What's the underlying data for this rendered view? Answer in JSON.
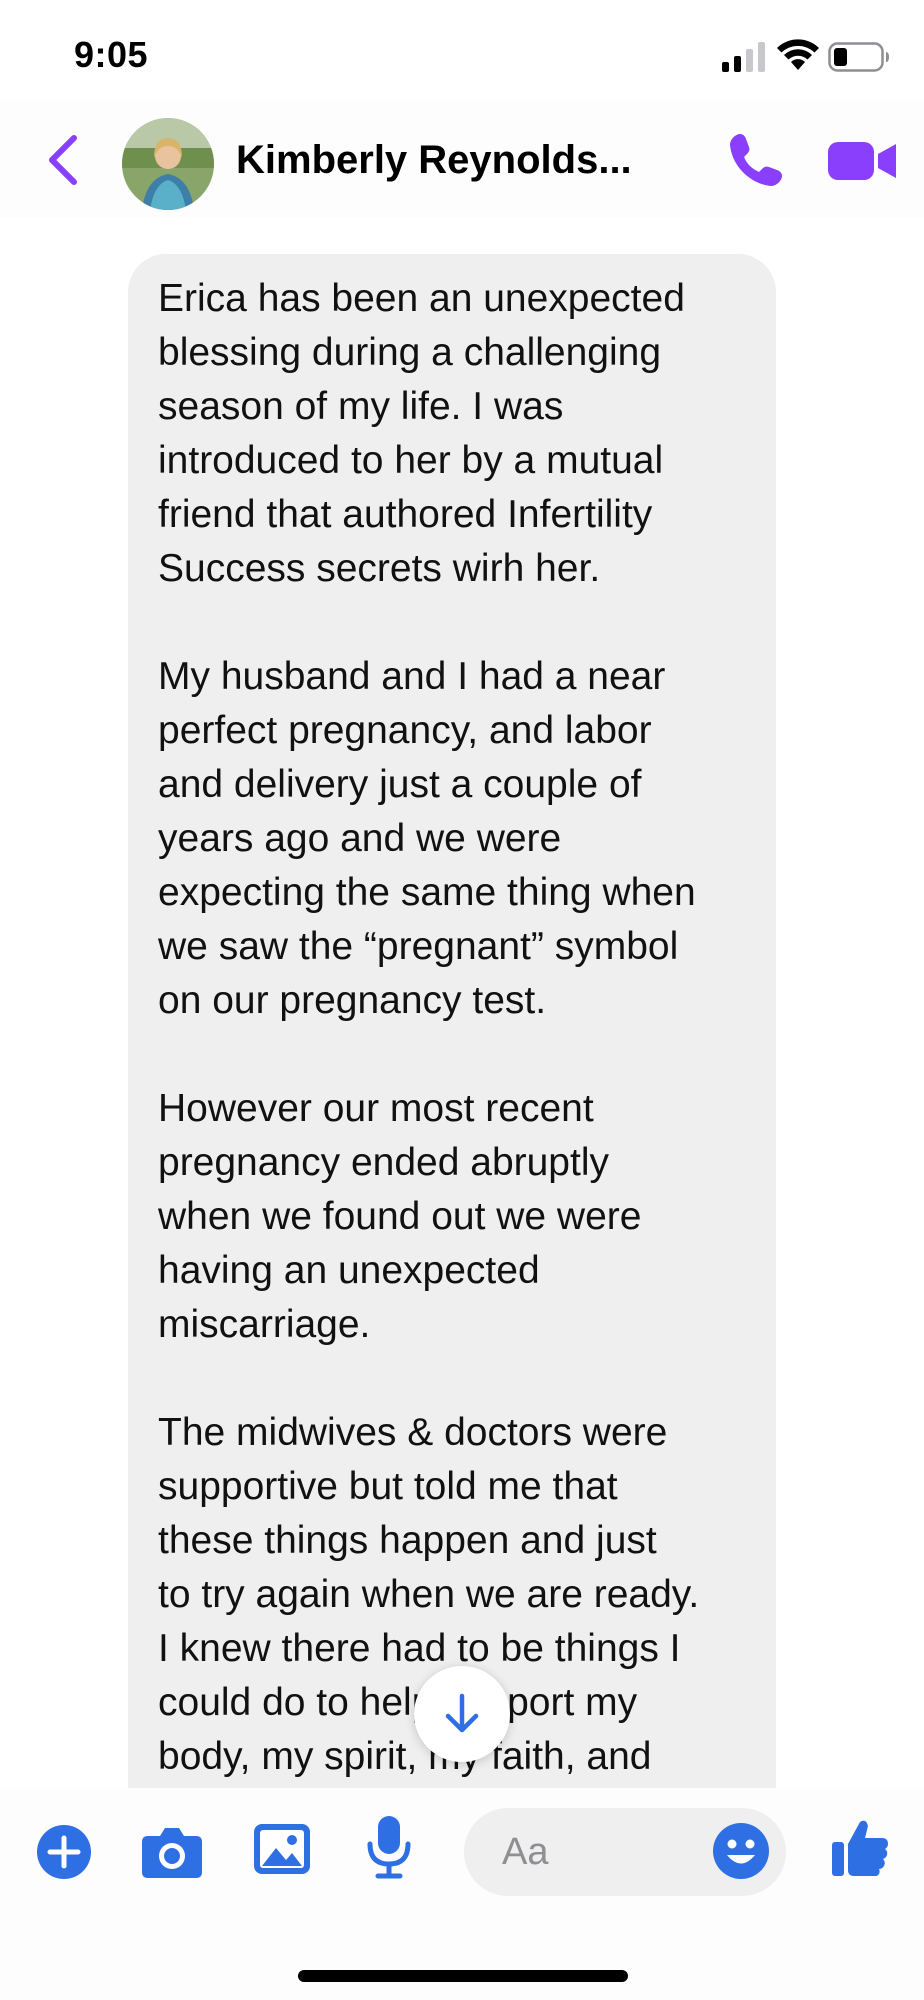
{
  "status_bar": {
    "time": "9:05"
  },
  "header": {
    "contact_name": "Kimberly Reynolds...",
    "accent_color": "#8a3ffc"
  },
  "message": {
    "text": "Erica has been an unexpected\nblessing during a challenging\nseason of my life. I was\nintroduced to her by a mutual\nfriend that authored Infertility\nSuccess secrets wirh her.\n\nMy husband and I had a near\nperfect pregnancy, and labor\nand delivery just a couple of\nyears ago and we were\nexpecting the same thing when\nwe saw the “pregnant” symbol\non our pregnancy test.\n\nHowever our most recent\npregnancy ended abruptly\nwhen we found out we were\nhaving an unexpected\nmiscarriage.\n\nThe midwives & doctors were\nsupportive but told me that\nthese things happen and just\nto try again when we are ready.\nI knew there had to be things I\ncould do to help support my\nbody, my spirit, my faith, and"
  },
  "composer": {
    "placeholder": "Aa",
    "icon_color": "#2f6fe4"
  },
  "icons": [
    "signal-icon",
    "wifi-icon",
    "battery-icon",
    "back-chevron-icon",
    "phone-icon",
    "video-camera-icon",
    "arrow-down-icon",
    "plus-icon",
    "camera-icon",
    "gallery-icon",
    "microphone-icon",
    "emoji-icon",
    "thumbs-up-icon"
  ]
}
